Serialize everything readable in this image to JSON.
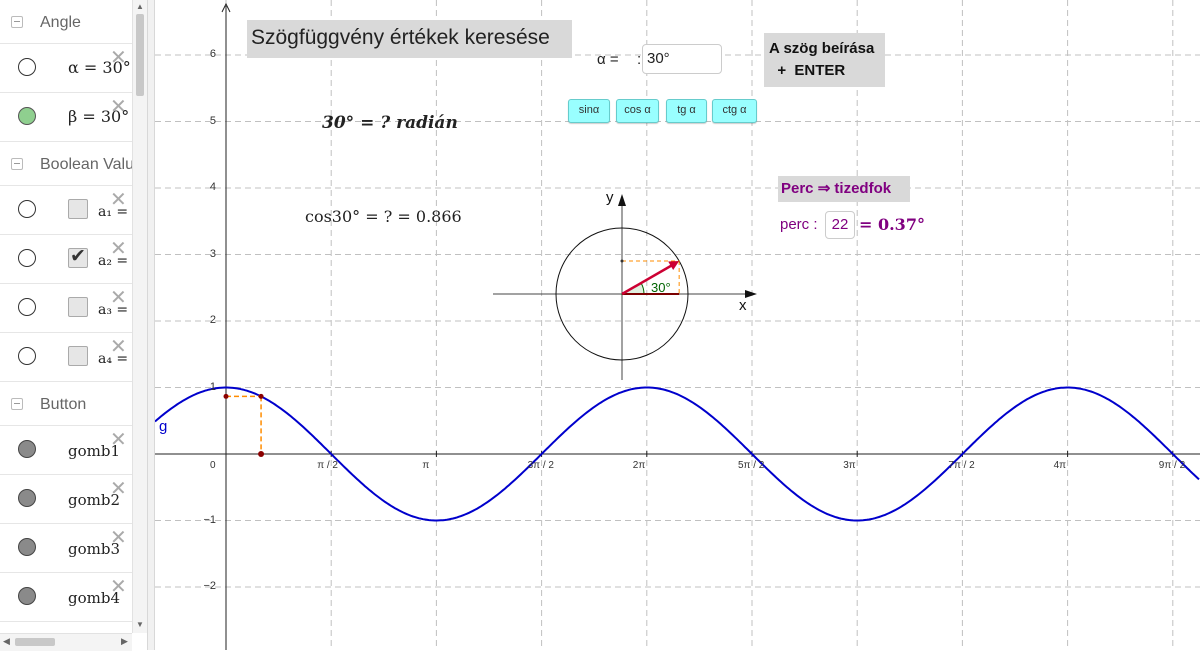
{
  "sidebar": {
    "categories": {
      "angle": "Angle",
      "boolean": "Boolean Valu",
      "button": "Button"
    },
    "angles": [
      {
        "label": "α = 30°"
      },
      {
        "label": "β = 30°"
      }
    ],
    "booleans": [
      {
        "name": "a₁ =",
        "checked": false
      },
      {
        "name": "a₂ =",
        "checked": true
      },
      {
        "name": "a₃ =",
        "checked": false
      },
      {
        "name": "a₄ =",
        "checked": false
      }
    ],
    "buttons": [
      {
        "label": "gomb1"
      },
      {
        "label": "gomb2"
      },
      {
        "label": "gomb3"
      },
      {
        "label": "gomb4"
      }
    ],
    "delete_glyph": "✕"
  },
  "graphics": {
    "title": "Szögfüggvény értékek  keresése",
    "alpha_label": "α  =",
    "alpha_colon": ":",
    "alpha_value": "30°",
    "hint_line1": "A szög beírása",
    "hint_line2": "  +  ENTER",
    "trig_buttons": [
      "sinα",
      "cos α",
      "tg α",
      "ctg α"
    ],
    "radian_question": "30° = ?  radián",
    "cos_formula": "cos30° = ? = 0.866",
    "perc_title": "Perc  ⇒  tizedfok",
    "perc_label": "perc  :",
    "perc_value": "22",
    "perc_result": "= 0.37°",
    "axis_x": "x",
    "axis_y": "y",
    "angle_label": "30°",
    "curve_label": "g",
    "y_ticks": [
      "6",
      "5",
      "4",
      "3",
      "2",
      "1",
      "−1",
      "−2"
    ],
    "x_ticks": [
      "0",
      "π / 2",
      "π",
      "3π / 2",
      "2π",
      "5π / 2",
      "3π",
      "7π / 2",
      "4π",
      "9π / 2"
    ]
  },
  "colors": {
    "curve": "#0000cc",
    "trig_button": "#99ffff",
    "perc_text": "#800080",
    "vector": "#cc0033",
    "guide": "#ff8c00"
  }
}
